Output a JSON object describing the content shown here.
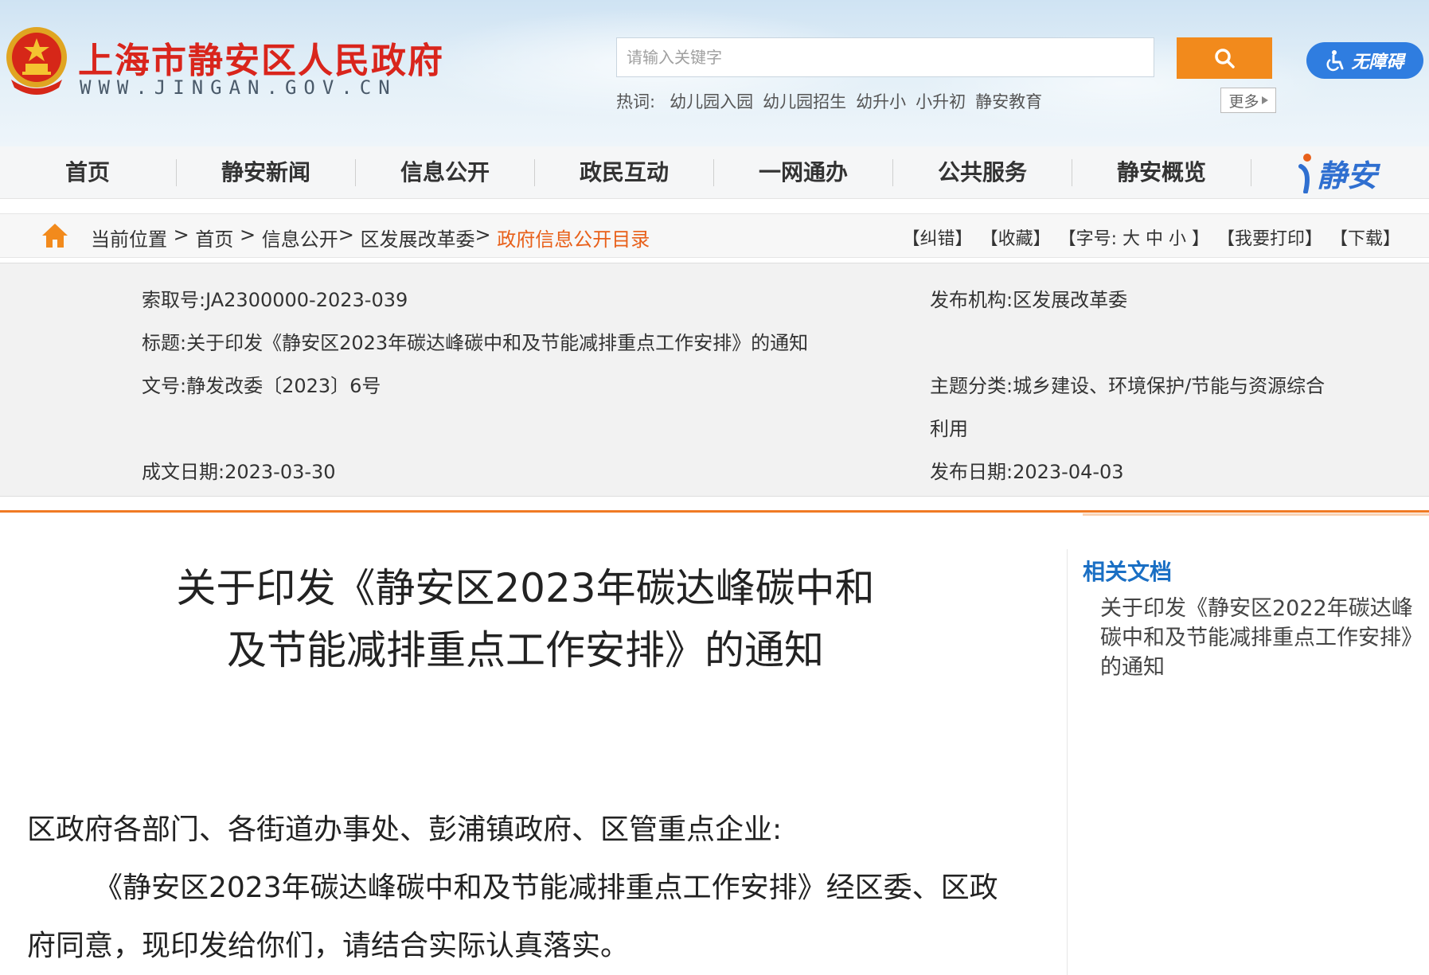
{
  "header": {
    "site_title": "上海市静安区人民政府",
    "site_url": "WWW.JINGAN.GOV.CN",
    "search_placeholder": "请输入关键字",
    "accessibility_label": "无障碍",
    "hot_label": "热词:",
    "hot_words": [
      "幼儿园入园",
      "幼儿园招生",
      "幼升小",
      "小升初",
      "静安教育"
    ],
    "more_label": "更多"
  },
  "nav": {
    "items": [
      "首页",
      "静安新闻",
      "信息公开",
      "政民互动",
      "一网通办",
      "公共服务",
      "静安概览"
    ],
    "logo_text": "静安"
  },
  "breadcrumb": {
    "prefix": "当前位置",
    "path": [
      "首页",
      "信息公开",
      "区发展改革委"
    ],
    "current": "政府信息公开目录",
    "tools": [
      "【纠错】",
      "【收藏】",
      "【字号: 大 中 小 】",
      "【我要打印】",
      "【下载】"
    ]
  },
  "meta": {
    "index_no": "索取号:JA2300000-2023-039",
    "publisher": "发布机构:区发展改革委",
    "title": "标题:关于印发《静安区2023年碳达峰碳中和及节能减排重点工作安排》的通知",
    "doc_no": "文号:静发改委〔2023〕6号",
    "category_line1": "主题分类:城乡建设、环境保护/节能与资源综合",
    "category_line2": "利用",
    "written_date": "成文日期:2023-03-30",
    "publish_date": "发布日期:2023-04-03"
  },
  "article": {
    "title_line1": "关于印发《静安区2023年碳达峰碳中和",
    "title_line2": "及节能减排重点工作安排》的通知",
    "recipients": "区政府各部门、各街道办事处、彭浦镇政府、区管重点企业:",
    "body_line1": "《静安区2023年碳达峰碳中和及节能减排重点工作安排》经区委、区政",
    "body_line2": "府同意，现印发给你们，请结合实际认真落实。"
  },
  "sidebar": {
    "heading": "相关文档",
    "link": "关于印发《静安区2022年碳达峰碳中和及节能减排重点工作安排》的通知"
  },
  "colors": {
    "title_red": "#d9251c",
    "accent_orange": "#f28a1c",
    "link_blue": "#1a6fc4",
    "access_blue": "#2f7de0"
  }
}
